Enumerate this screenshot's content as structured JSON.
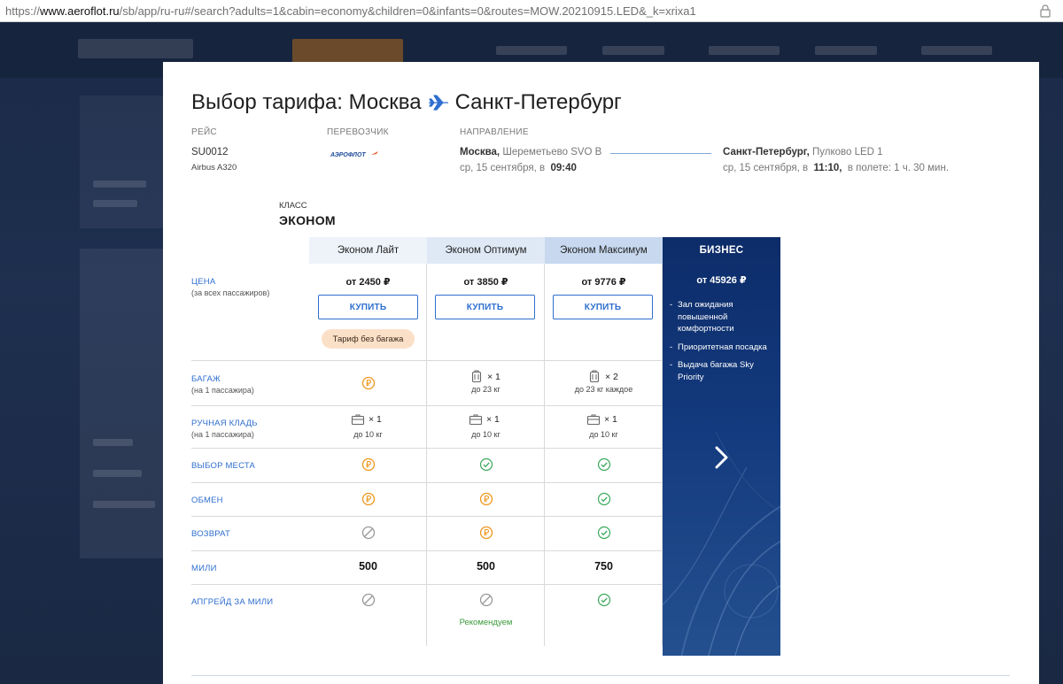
{
  "browser": {
    "url_prefix": "https://",
    "url_domain": "www.aeroflot.ru",
    "url_rest": "/sb/app/ru-ru#/search?adults=1&cabin=economy&children=0&infants=0&routes=MOW.20210915.LED&_k=xrixa1"
  },
  "modal": {
    "title_from": "Выбор тарифа: Москва",
    "title_to": "Санкт-Петербург",
    "flight_label": "РЕЙС",
    "carrier_label": "ПЕРЕВОЗЧИК",
    "direction_label": "НАПРАВЛЕНИЕ",
    "flight_number": "SU0012",
    "aircraft": "Airbus A320",
    "carrier_logo_text": "АЭРОФЛОТ",
    "origin_city": "Москва,",
    "origin_airport": "Шереметьево SVO B",
    "origin_date": "ср, 15 сентября, в",
    "origin_time": "09:40",
    "dest_city": "Санкт-Петербург,",
    "dest_airport": "Пулково LED 1",
    "dest_date": "ср, 15 сентября, в",
    "dest_time": "11:10,",
    "duration": "в полете: 1 ч. 30 мин."
  },
  "cabin": {
    "label": "КЛАСС",
    "name": "ЭКОНОМ"
  },
  "fares": [
    {
      "name": "Эконом Лайт",
      "price": "от 2450 ₽",
      "buy": "КУПИТЬ",
      "note": "Тариф без багажа"
    },
    {
      "name": "Эконом Оптимум",
      "price": "от 3850 ₽",
      "buy": "КУПИТЬ"
    },
    {
      "name": "Эконом Максимум",
      "price": "от 9776 ₽",
      "buy": "КУПИТЬ"
    }
  ],
  "business": {
    "name": "БИЗНЕС",
    "price": "от 45926 ₽",
    "features": [
      "Зал ожидания повышенной комфортности",
      "Приоритетная посадка",
      "Выдача багажа Sky Priority"
    ]
  },
  "rows": {
    "price": {
      "label": "ЦЕНА",
      "sub": "(за всех пассажиров)"
    },
    "baggage": {
      "label": "БАГАЖ",
      "sub": "(на 1 пассажира)"
    },
    "hand": {
      "label": "РУЧНАЯ КЛАДЬ",
      "sub": "(на 1 пассажира)"
    },
    "seat": {
      "label": "ВЫБОР МЕСТА"
    },
    "exchange": {
      "label": "ОБМЕН"
    },
    "refund": {
      "label": "ВОЗВРАТ"
    },
    "miles": {
      "label": "МИЛИ"
    },
    "upgrade": {
      "label": "АПГРЕЙД ЗА МИЛИ"
    }
  },
  "cells": {
    "baggage_opt_qty": "× 1",
    "baggage_opt_cap": "до 23 кг",
    "baggage_max_qty": "× 2",
    "baggage_max_cap": "до 23 кг каждое",
    "hand_qty": "× 1",
    "hand_cap": "до 10 кг",
    "miles_lite": "500",
    "miles_opt": "500",
    "miles_max": "750",
    "recommend": "Рекомендуем"
  },
  "icons": {
    "paid": "ruble-coin-icon",
    "included": "check-circle-icon",
    "unavailable": "prohibited-icon",
    "baggage": "suitcase-icon",
    "hand": "briefcase-icon"
  },
  "colors": {
    "accent": "#2f6fcf",
    "paid": "#f0961e",
    "included": "#3aa85a",
    "unavailable": "#999999",
    "business": "#0e2f6e"
  }
}
